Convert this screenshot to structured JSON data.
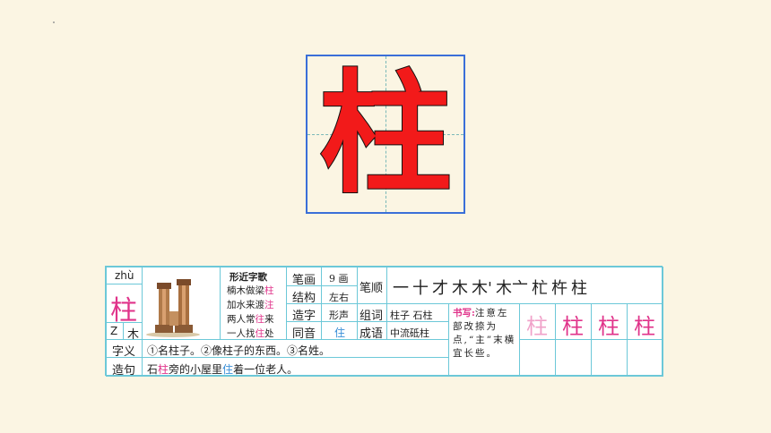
{
  "big_char": "柱",
  "card": {
    "pinyin": "zhù",
    "char": "柱",
    "radical_letter": "Z",
    "radical": "木",
    "poem": {
      "title": "形近字歌",
      "lines": [
        {
          "pre": "楠木做梁",
          "hl": "柱"
        },
        {
          "pre": "加水来渡",
          "hl": "注"
        },
        {
          "pre": "两人常",
          "hl": "往",
          "post": "来"
        },
        {
          "pre": "一人找",
          "hl": "住",
          "post": "处"
        }
      ]
    },
    "strokes_label": "笔画",
    "strokes_value": "9 画",
    "structure_label": "结构",
    "structure_value": "左右",
    "formation_label": "造字",
    "formation_value": "形声",
    "homophone_label": "同音",
    "homophone_value": "住",
    "order_label": "笔顺",
    "stroke_order": [
      "一",
      "十",
      "才",
      "木",
      "木'",
      "木亠",
      "杧",
      "杵",
      "柱"
    ],
    "words_label": "组词",
    "words_value": "柱子  石柱",
    "idiom_label": "成语",
    "idiom_value": "中流砥柱",
    "writing_label": "书写:",
    "writing_text": "注意左部改捺为点,“主”末横宜长些。",
    "practice_chars": [
      "柱",
      "柱",
      "柱",
      "柱"
    ],
    "meaning_label": "字义",
    "meaning_value": "①名柱子。②像柱子的东西。③名姓。",
    "sentence_label": "造句",
    "sentence_pre": "石",
    "sentence_hl1": "柱",
    "sentence_mid": "旁的小屋里",
    "sentence_hl2": "住",
    "sentence_post": "着一位老人。"
  }
}
